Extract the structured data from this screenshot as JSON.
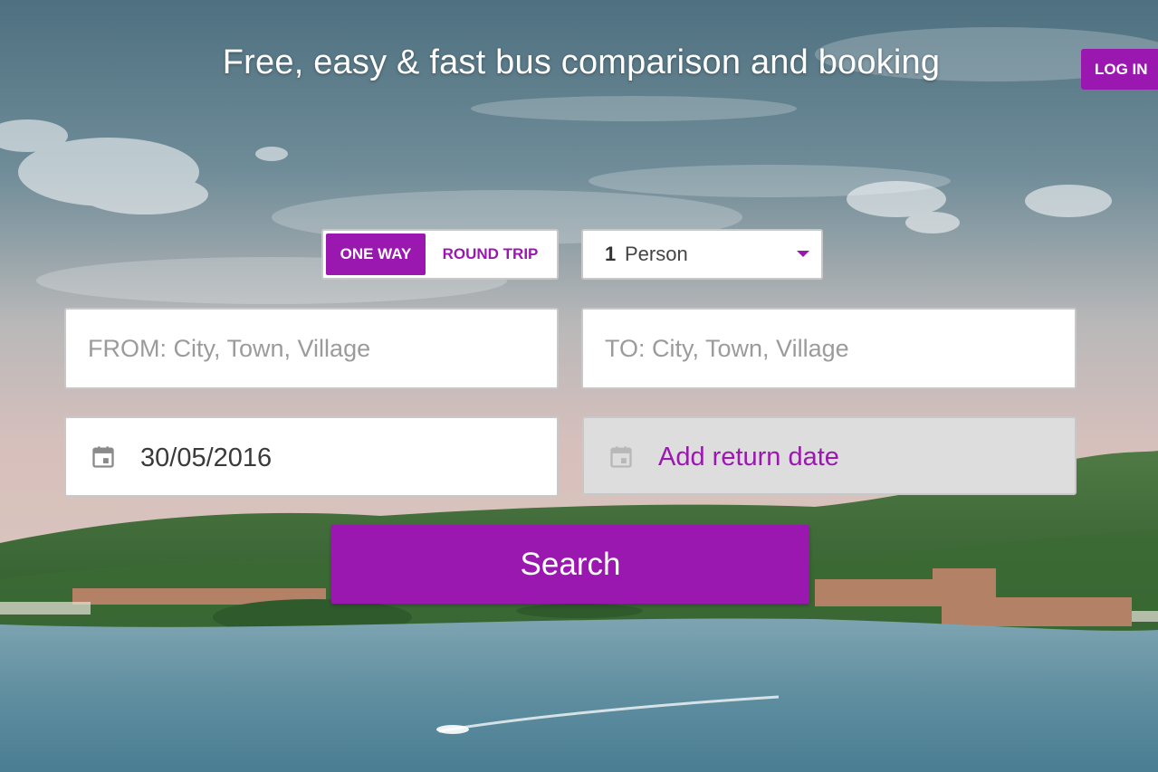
{
  "header": {
    "headline": "Free, easy & fast bus comparison and booking",
    "login_label": "LOG IN"
  },
  "trip_type": {
    "one_way_label": "ONE WAY",
    "round_trip_label": "ROUND TRIP",
    "selected": "ONE WAY"
  },
  "passengers": {
    "count": "1",
    "label": "Person"
  },
  "from": {
    "placeholder": "FROM: City, Town, Village",
    "value": ""
  },
  "to": {
    "placeholder": "TO: City, Town, Village",
    "value": ""
  },
  "departure": {
    "value": "30/05/2016",
    "icon": "calendar-icon"
  },
  "return": {
    "label": "Add return date",
    "icon": "calendar-icon"
  },
  "search": {
    "label": "Search"
  },
  "colors": {
    "accent": "#9a18b0",
    "disabled_field": "#dddddd",
    "field_border": "#c8c8c8"
  }
}
